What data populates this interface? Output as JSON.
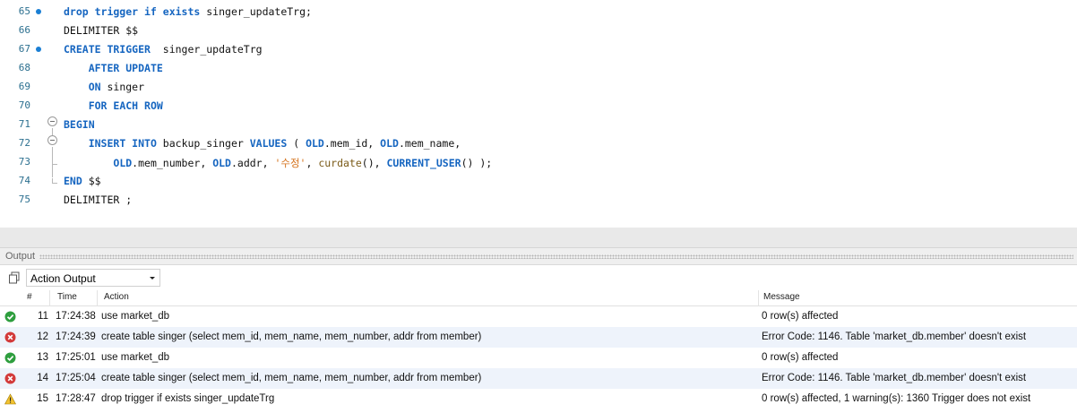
{
  "editor": {
    "lines": [
      {
        "num": "65",
        "dot": true,
        "tokens": [
          {
            "t": "drop trigger if exists",
            "c": "kw"
          },
          {
            "t": " singer_updateTrg;",
            "c": ""
          }
        ]
      },
      {
        "num": "66",
        "dot": false,
        "tokens": [
          {
            "t": "DELIMITER $$",
            "c": ""
          }
        ]
      },
      {
        "num": "67",
        "dot": true,
        "tokens": [
          {
            "t": "CREATE TRIGGER",
            "c": "kw"
          },
          {
            "t": "  singer_updateTrg",
            "c": ""
          }
        ]
      },
      {
        "num": "68",
        "dot": false,
        "tokens": [
          {
            "t": "    ",
            "c": ""
          },
          {
            "t": "AFTER UPDATE",
            "c": "kw"
          }
        ]
      },
      {
        "num": "69",
        "dot": false,
        "tokens": [
          {
            "t": "    ",
            "c": ""
          },
          {
            "t": "ON",
            "c": "kw"
          },
          {
            "t": " singer",
            "c": ""
          }
        ]
      },
      {
        "num": "70",
        "dot": false,
        "tokens": [
          {
            "t": "    ",
            "c": ""
          },
          {
            "t": "FOR EACH ROW",
            "c": "kw"
          }
        ]
      },
      {
        "num": "71",
        "dot": false,
        "tokens": [
          {
            "t": "BEGIN",
            "c": "kw"
          }
        ]
      },
      {
        "num": "72",
        "dot": false,
        "tokens": [
          {
            "t": "    ",
            "c": ""
          },
          {
            "t": "INSERT INTO",
            "c": "kw"
          },
          {
            "t": " backup_singer ",
            "c": ""
          },
          {
            "t": "VALUES",
            "c": "kw"
          },
          {
            "t": " ( ",
            "c": ""
          },
          {
            "t": "OLD",
            "c": "kw"
          },
          {
            "t": ".mem_id, ",
            "c": ""
          },
          {
            "t": "OLD",
            "c": "kw"
          },
          {
            "t": ".mem_name,",
            "c": ""
          }
        ]
      },
      {
        "num": "73",
        "dot": false,
        "tokens": [
          {
            "t": "        ",
            "c": ""
          },
          {
            "t": "OLD",
            "c": "kw"
          },
          {
            "t": ".mem_number, ",
            "c": ""
          },
          {
            "t": "OLD",
            "c": "kw"
          },
          {
            "t": ".addr, ",
            "c": ""
          },
          {
            "t": "'수정'",
            "c": "str"
          },
          {
            "t": ", ",
            "c": ""
          },
          {
            "t": "curdate",
            "c": "fn"
          },
          {
            "t": "(), ",
            "c": ""
          },
          {
            "t": "CURRENT_USER",
            "c": "kw"
          },
          {
            "t": "() );",
            "c": ""
          }
        ]
      },
      {
        "num": "74",
        "dot": false,
        "tokens": [
          {
            "t": "END",
            "c": "kw"
          },
          {
            "t": " $$",
            "c": ""
          }
        ]
      },
      {
        "num": "75",
        "dot": false,
        "tokens": [
          {
            "t": "DELIMITER ;",
            "c": ""
          }
        ]
      }
    ]
  },
  "output": {
    "title": "Output",
    "dropdown_value": "Action Output",
    "columns": {
      "num": "#",
      "time": "Time",
      "action": "Action",
      "message": "Message"
    },
    "rows": [
      {
        "status": "success",
        "num": "11",
        "time": "17:24:38",
        "action": "use market_db",
        "message": "0 row(s) affected"
      },
      {
        "status": "error",
        "num": "12",
        "time": "17:24:39",
        "action": "create table singer (select mem_id, mem_name, mem_number, addr from member)",
        "message": "Error Code: 1146. Table 'market_db.member' doesn't exist"
      },
      {
        "status": "success",
        "num": "13",
        "time": "17:25:01",
        "action": "use market_db",
        "message": "0 row(s) affected"
      },
      {
        "status": "error",
        "num": "14",
        "time": "17:25:04",
        "action": "create table singer (select mem_id, mem_name, mem_number, addr from member)",
        "message": "Error Code: 1146. Table 'market_db.member' doesn't exist"
      },
      {
        "status": "warning",
        "num": "15",
        "time": "17:28:47",
        "action": "drop trigger if exists singer_updateTrg",
        "message": "0 row(s) affected, 1 warning(s): 1360 Trigger does not exist"
      }
    ]
  },
  "colors": {
    "success": "#2e9e3e",
    "error": "#d33a3a",
    "warning": "#f2c230",
    "keyword": "#1565c0",
    "string": "#d4721c"
  }
}
